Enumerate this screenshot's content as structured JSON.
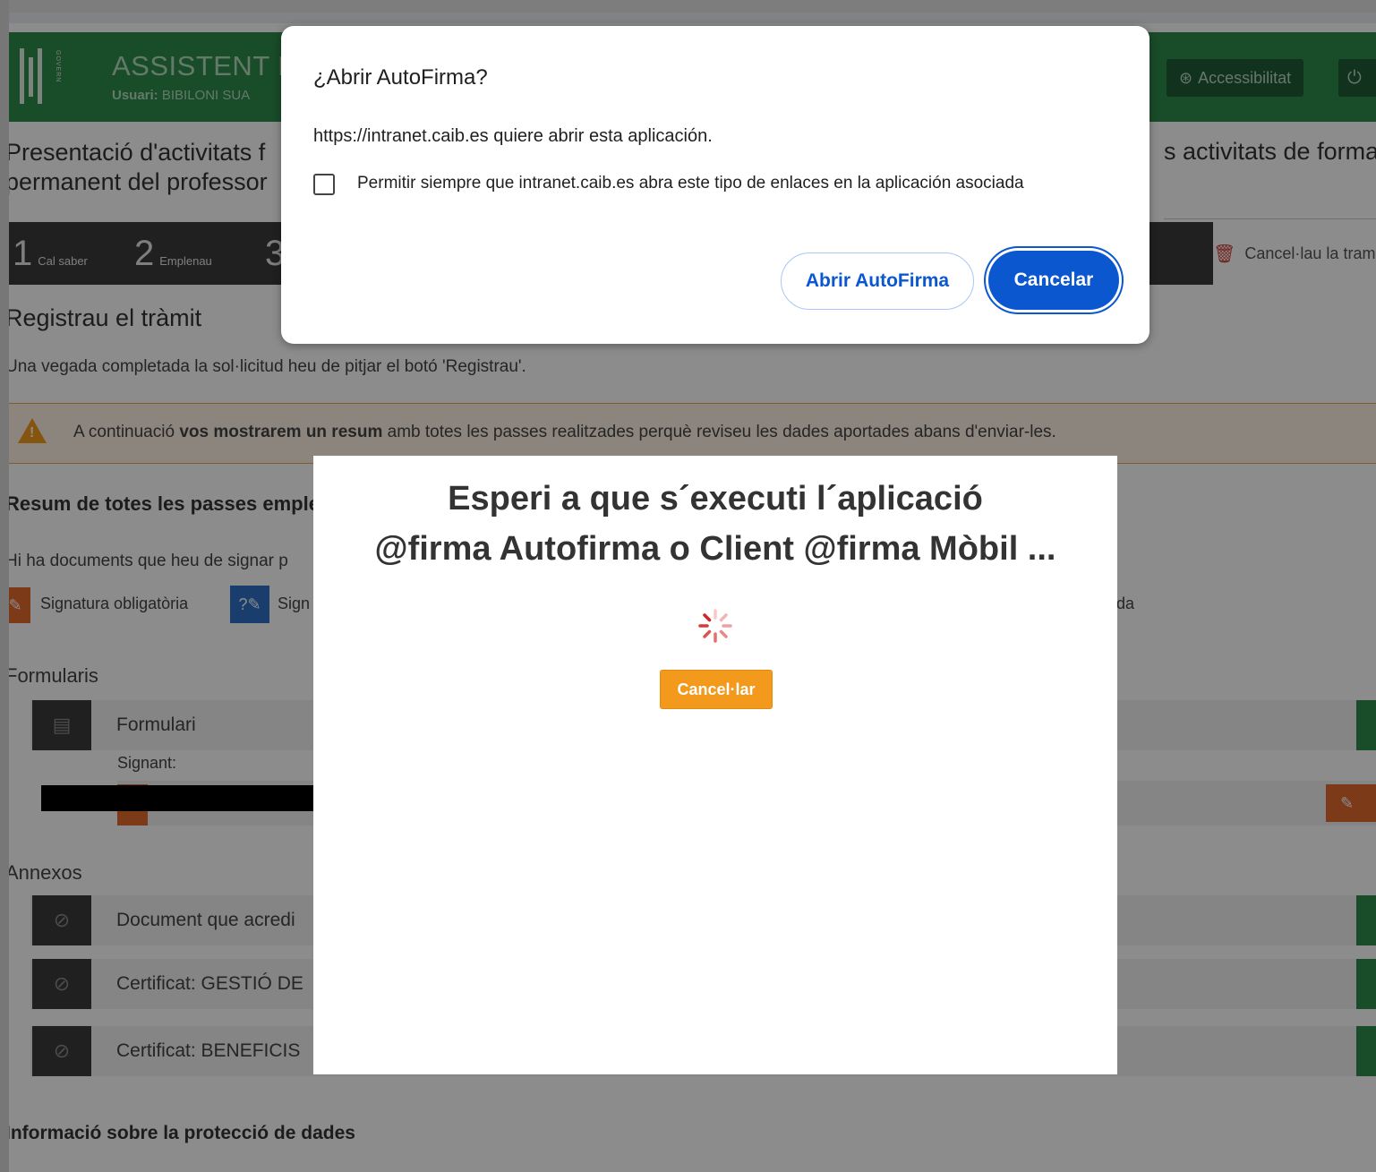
{
  "header": {
    "title": "ASSISTENT D",
    "user_label": "Usuari:",
    "user_name": "BIBILONI SUA",
    "logo_text": "GOVERN",
    "accessibility_label": "Accessibilitat"
  },
  "page": {
    "title_line1": "Presentació d'activitats f",
    "title_line2": "permanent del professor",
    "title_right": "s activitats de forma"
  },
  "steps": [
    {
      "num": "1",
      "label": "Cal saber"
    },
    {
      "num": "2",
      "label": "Emplenau"
    },
    {
      "num": "3",
      "label": ""
    }
  ],
  "cancel_tramit_label": "Cancel·lau la tram",
  "register": {
    "heading": "Registrau el tràmit",
    "text": "Una vegada completada la sol·licitud heu de pitjar el botó 'Registrau'."
  },
  "warning": {
    "prefix": "A continuació",
    "bold": "vos mostrarem un resum",
    "suffix": "amb totes les passes realitzades perquè reviseu les dades aportades abans d'enviar-les."
  },
  "summary": {
    "heading": "Resum de totes les passes emplen",
    "docs_text": "Hi ha documents que heu de signar p",
    "legend": [
      {
        "label": "Signatura obligatòria"
      },
      {
        "label": "Sign"
      },
      {
        "label": "tada"
      }
    ]
  },
  "forms": {
    "heading": "Formularis",
    "items": [
      {
        "label": "Formulari"
      }
    ],
    "signant_label": "Signant:"
  },
  "annexes": {
    "heading": "Annexos",
    "items": [
      {
        "label": "Document que acredi"
      },
      {
        "label": "Certificat: GESTIÓ DE"
      },
      {
        "label": "Certificat: BENEFICIS"
      }
    ]
  },
  "privacy_heading": "Informació sobre la protecció de dades",
  "wait_modal": {
    "title_line1": "Esperi a que s´executi l´aplicació",
    "title_line2": "@firma Autofirma o Client @firma Mòbil ...",
    "cancel_label": "Cancel·lar"
  },
  "prompt": {
    "title": "¿Abrir AutoFirma?",
    "message": "https://intranet.caib.es quiere abrir esta aplicación.",
    "checkbox_label": "Permitir siempre que intranet.caib.es abra este tipo de enlaces en la aplicación asociada",
    "open_label": "Abrir AutoFirma",
    "cancel_label": "Cancelar"
  },
  "colors": {
    "header_green": "#2f8a4b",
    "step_bar": "#3b3b3b",
    "warning_orange": "#f39a1c",
    "signature_orange": "#e26a2c",
    "signature_blue": "#2f6fc5",
    "prompt_blue": "#0b57d0"
  },
  "icons": {
    "accessibility": "accessibility-icon",
    "power": "power-icon",
    "trash": "trash-icon",
    "warning": "warning-icon",
    "form": "clipboard-icon",
    "attachment": "paperclip-icon",
    "signature": "pen-icon",
    "spinner": "spinner-icon"
  }
}
